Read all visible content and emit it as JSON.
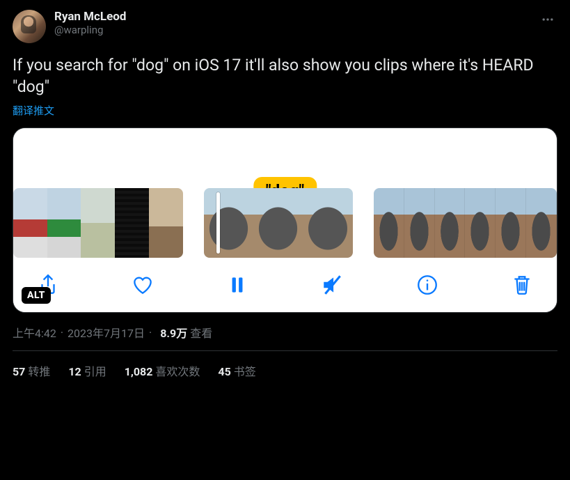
{
  "author": {
    "display_name": "Ryan McLeod",
    "handle": "@warpling"
  },
  "tweet_text": "If you search for \"dog\" on iOS 17 it'll also show you clips where it's HEARD \"dog\"",
  "translate_label": "翻译推文",
  "media": {
    "tooltip": "\"dog\"",
    "alt_badge": "ALT",
    "toolbar_icons": {
      "share": "share-icon",
      "like": "heart-icon",
      "pause": "pause-icon",
      "mute": "mute-icon",
      "info": "info-icon",
      "trash": "trash-icon"
    }
  },
  "timestamp": {
    "time": "上午4:42",
    "date": "2023年7月17日"
  },
  "views": {
    "count": "8.9万",
    "label": "查看"
  },
  "stats": {
    "retweets": {
      "n": "57",
      "label": "转推"
    },
    "quotes": {
      "n": "12",
      "label": "引用"
    },
    "likes": {
      "n": "1,082",
      "label": "喜欢次数"
    },
    "bookmarks": {
      "n": "45",
      "label": "书签"
    }
  }
}
